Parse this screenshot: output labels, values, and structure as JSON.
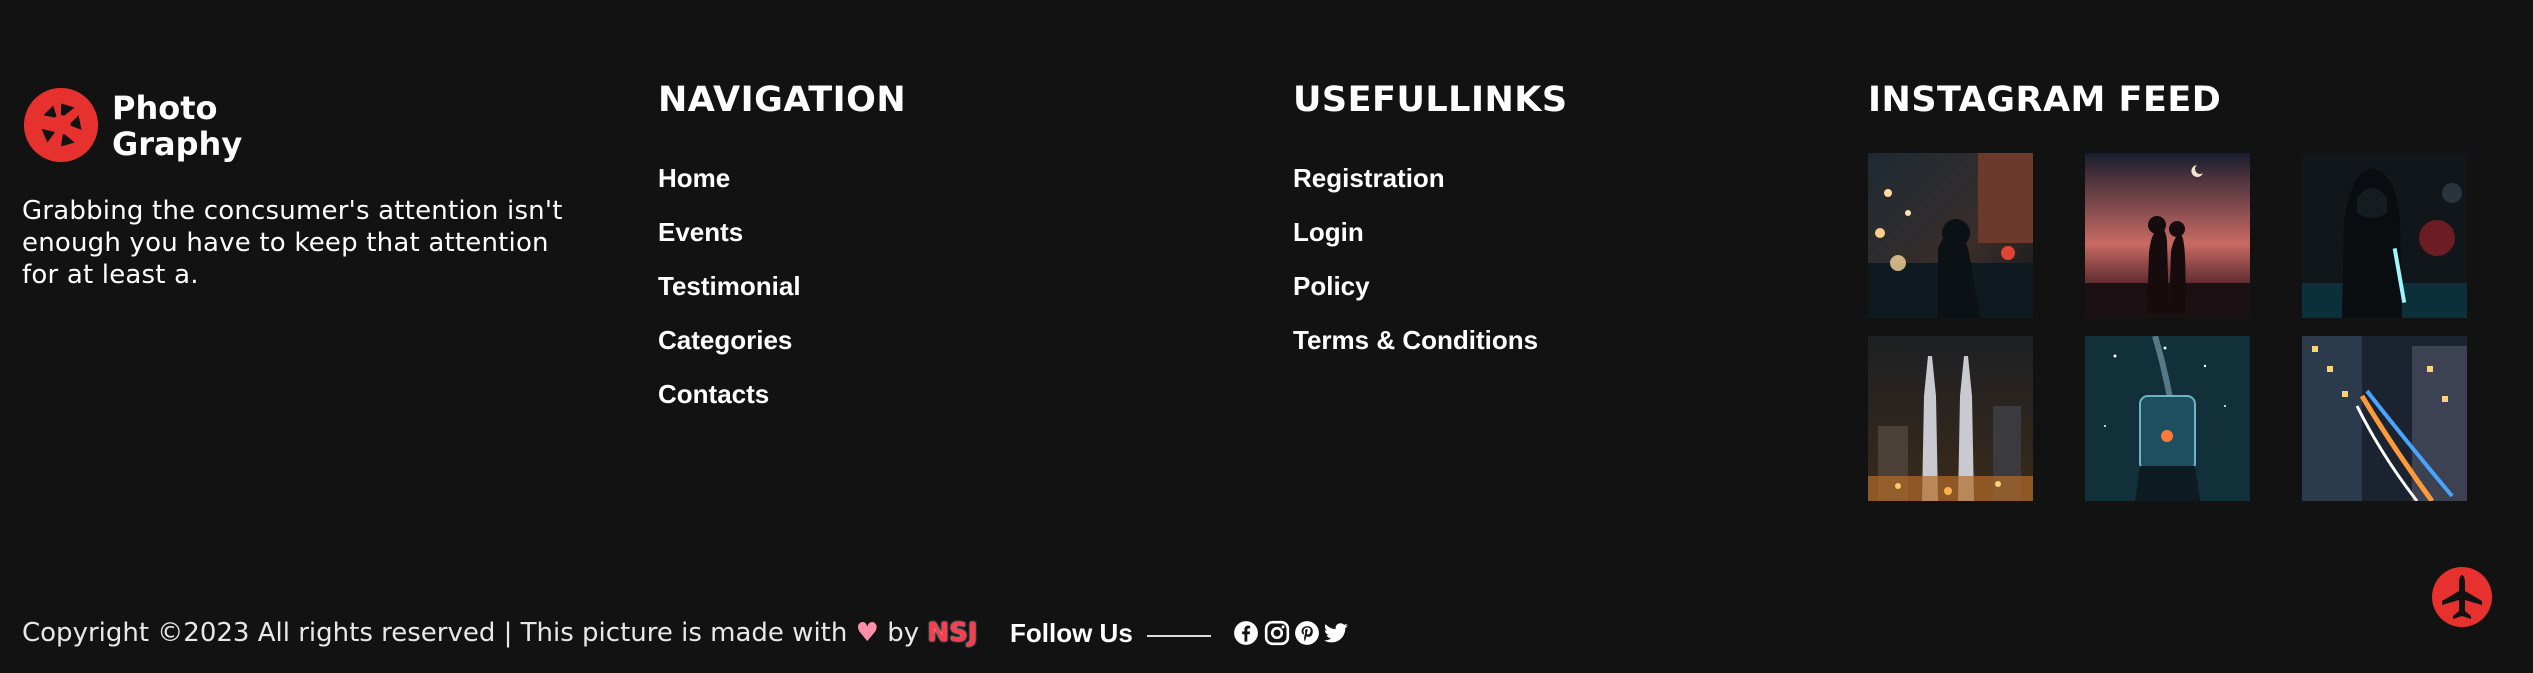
{
  "brand": {
    "name_line1": "Photo",
    "name_line2": "Graphy",
    "description": "Grabbing the concsumer's attention isn't enough you have to keep that attention for at least a.",
    "accent": "#e6312f"
  },
  "navigation": {
    "title": "NAVIGATION",
    "items": [
      "Home",
      "Events",
      "Testimonial",
      "Categories",
      "Contacts"
    ]
  },
  "useful_links": {
    "title": "USEFULLINKS",
    "items": [
      "Registration",
      "Login",
      "Policy",
      "Terms & Conditions"
    ]
  },
  "instagram": {
    "title": "INSTAGRAM FEED",
    "photos": [
      "rainy-night-street",
      "couple-sunset-silhouette",
      "hooded-figure-neon",
      "twin-towers-night",
      "jar-of-stars",
      "city-light-trails"
    ]
  },
  "footer": {
    "copyright_text": "Copyright ©2023 All rights reserved | This picture is made with",
    "by_text": "by",
    "author": "NSJ",
    "heart_icon": "heart-icon",
    "follow_label": "Follow Us",
    "social_icons": [
      "facebook-icon",
      "instagram-icon",
      "pinterest-icon",
      "twitter-icon"
    ]
  },
  "scroll_top_icon": "jet-icon"
}
